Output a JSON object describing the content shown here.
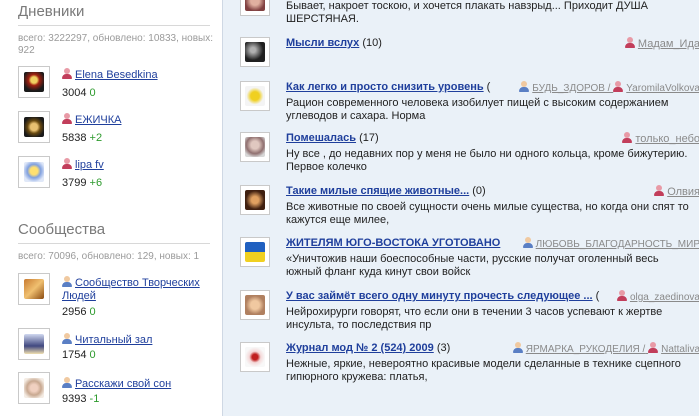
{
  "diaries": {
    "title": "Дневники",
    "stats": "всего: 3222297, обновлено: 10833, новых: 922",
    "items": [
      {
        "name": "Elena Besedkina",
        "count": "3004",
        "delta": "0"
      },
      {
        "name": "ЕЖИЧКА",
        "count": "5838",
        "delta": "+2"
      },
      {
        "name": "lipa fv",
        "count": "3799",
        "delta": "+6"
      }
    ]
  },
  "communities": {
    "title": "Сообщества",
    "stats": "всего: 70096, обновлено: 129, новых: 1",
    "items": [
      {
        "name_line1": "Сообщество Творческих",
        "name_line2": "Людей",
        "count": "2956",
        "delta": "0"
      },
      {
        "name_line1": "Читальный зал",
        "name_line2": "",
        "count": "1754",
        "delta": "0"
      },
      {
        "name_line1": "Расскажи свой сон",
        "name_line2": "",
        "count": "9393",
        "delta": "-1"
      }
    ]
  },
  "feed": {
    "top_text_line1": "Бывает, накроет тоскою, и хочется плакать навзрыд... Приходит ДУША",
    "top_text_line2": "ШЕРСТЯНАЯ.",
    "posts": [
      {
        "title": "Мысли вслух",
        "count": "(10)",
        "author": "Мадам_Ида",
        "text1": "",
        "text2": ""
      },
      {
        "title": "Как легко и просто снизить уровень",
        "count": "(",
        "author": "БУДЬ_ЗДОРОВ /",
        "author2": "YaromilaVolkova",
        "text1": "Рацион современного человека изобилует пищей с высоким содержанием",
        "text2": "углеводов и сахара. Норма"
      },
      {
        "title": "Помешалась",
        "count": "(17)",
        "author": "только_небо",
        "text1": "Ну все , до недавних пор у меня не было ни одного кольца, кроме бижутерию.",
        "text2": "Первое колечко"
      },
      {
        "title": "Такие милые спящие животные...",
        "count": "(0)",
        "author": "Олвия",
        "text1": "Все животные по своей сущности очень милые существа, но когда они спят то",
        "text2": "кажутся еще милее,"
      },
      {
        "title": "ЖИТЕЛЯМ ЮГО-ВОСТОКА УГОТОВАНО",
        "count": "",
        "author": "ЛЮБОВЬ_БЛАГОДАРНОСТЬ_МИР",
        "text1": "«Уничтожив наши боеспособные части, русские получат оголенный весь",
        "text2": "южный фланг куда кинут свои войск"
      },
      {
        "title": "У вас займёт всего одну минуту прочесть следующее ...",
        "count": "(",
        "author": "olga_zaedinova",
        "text1": "Нейрохирурги говорят, что если они в течении 3 часов успевают к жертве",
        "text2": "инсульта, то последствия пр"
      },
      {
        "title": "Журнал мод № 2 (524) 2009",
        "count": "(3)",
        "author": "ЯРМАРКА_РУКОДЕЛИЯ /",
        "author2": "Nattaliva",
        "text1": "Нежные, яркие, невероятно красивые модели сделанные в технике сцепного",
        "text2": "гипюрного кружева: платья,"
      }
    ]
  },
  "colors": {
    "link": "#1f3f9c",
    "delta_positive": "#2d9a2d",
    "panel_bg": "#eaf1f8"
  }
}
